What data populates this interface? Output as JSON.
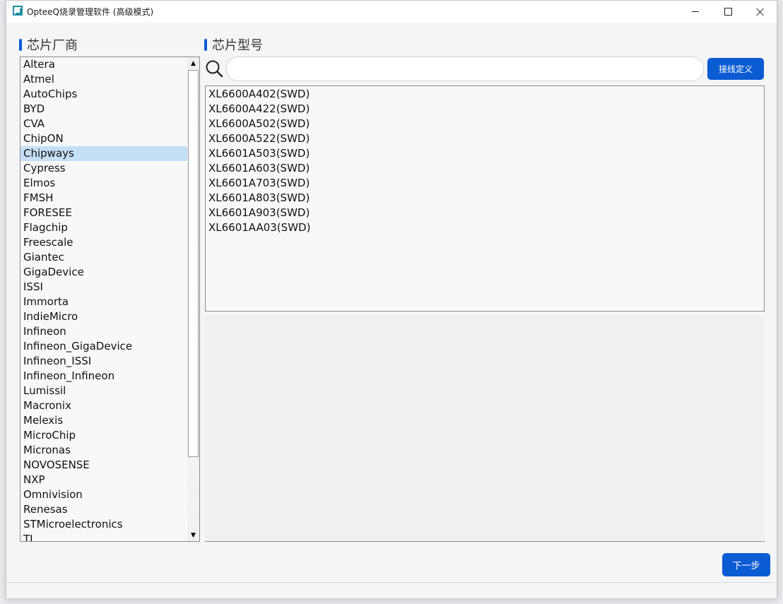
{
  "window": {
    "title": "OpteeQ烧录管理软件 (高级模式)"
  },
  "vendor_panel": {
    "title": "芯片厂商",
    "selected": "Chipways",
    "items": [
      "Altera",
      "Atmel",
      "AutoChips",
      "BYD",
      "CVA",
      "ChipON",
      "Chipways",
      "Cypress",
      "Elmos",
      "FMSH",
      "FORESEE",
      "Flagchip",
      "Freescale",
      "Giantec",
      "GigaDevice",
      "ISSI",
      "Immorta",
      "IndieMicro",
      "Infineon",
      "Infineon_GigaDevice",
      "Infineon_ISSI",
      "Infineon_Infineon",
      "Lumissil",
      "Macronix",
      "Melexis",
      "MicroChip",
      "Micronas",
      "NOVOSENSE",
      "NXP",
      "Omnivision",
      "Renesas",
      "STMicroelectronics",
      "TI"
    ]
  },
  "model_panel": {
    "title": "芯片型号",
    "search_value": "",
    "search_placeholder": "",
    "wiring_button": "接线定义",
    "items": [
      "XL6600A402(SWD)",
      "XL6600A422(SWD)",
      "XL6600A502(SWD)",
      "XL6600A522(SWD)",
      "XL6601A503(SWD)",
      "XL6601A603(SWD)",
      "XL6601A703(SWD)",
      "XL6601A803(SWD)",
      "XL6601A903(SWD)",
      "XL6601AA03(SWD)"
    ]
  },
  "footer": {
    "next_button": "下一步"
  },
  "colors": {
    "accent": "#0b5bd3",
    "selection": "#c5dff6"
  },
  "icons": {
    "search": "search-icon",
    "scroll_up": "scroll-up-arrow-icon",
    "scroll_down": "scroll-down-arrow-icon"
  }
}
